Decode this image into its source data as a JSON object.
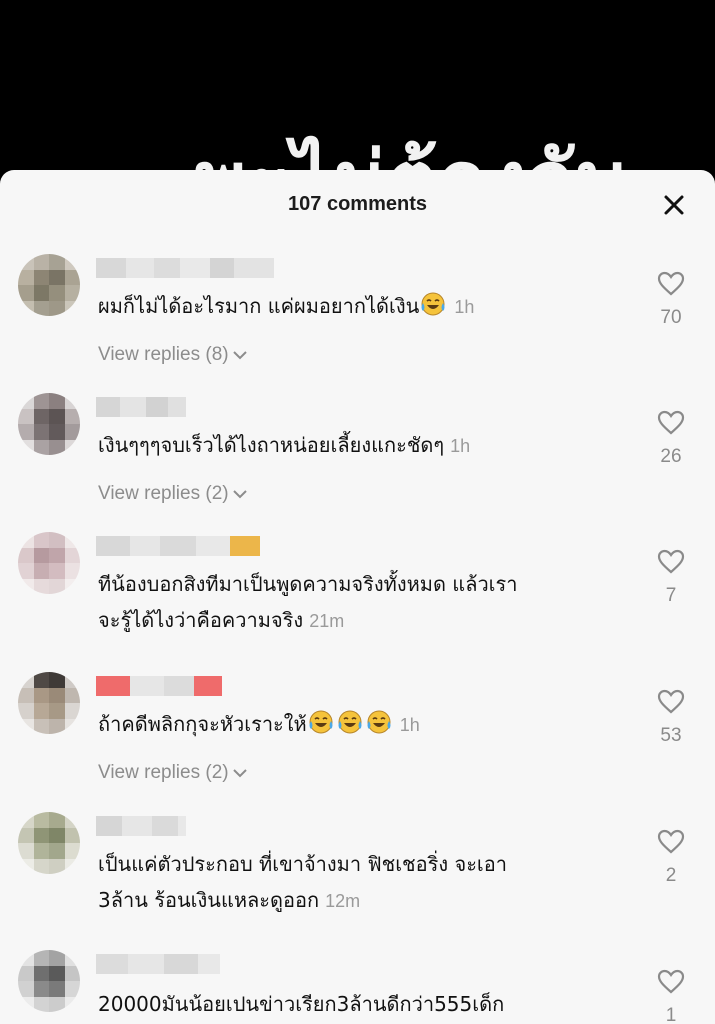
{
  "video": {
    "caption": "พะไม่ต้องจับ"
  },
  "sheet": {
    "title": "107 comments"
  },
  "comments": [
    {
      "text": "ผมก็ไม่ได้อะไรมาก แค่ผมอยากได้เงิน",
      "emojis": 1,
      "time": "1h",
      "likes": "70",
      "replies": "View replies (8)"
    },
    {
      "text": "เงินๆๆๆจบเร็วได้ไงถาหน่อยเลี้ยงแกะชัดๆ",
      "emojis": 0,
      "time": "1h",
      "likes": "26",
      "replies": "View replies (2)"
    },
    {
      "text": "ทีน้องบอกสิงทีมาเป็นพูดความจริงทั้งหมด แล้วเรา",
      "text2": "จะรู้ได้ไงว่าคือความจริง",
      "emojis": 0,
      "time": "21m",
      "likes": "7",
      "replies": ""
    },
    {
      "text": "ถ้าคดีพลิกกุจะหัวเราะให้",
      "emojis": 3,
      "time": "1h",
      "likes": "53",
      "replies": "View replies (2)"
    },
    {
      "text": "เป็นแค่ตัวประกอบ ที่เขาจ้างมา ฟิชเชอริ่ง จะเอา",
      "text2": "3ล้าน ร้อนเงินแหละดูออก",
      "emojis": 0,
      "time": "12m",
      "likes": "2",
      "replies": ""
    },
    {
      "text": "20000มันน้อยเปนข่าวเรียก3ล้านดีกว่า555เด็ก",
      "emojis": 0,
      "time": "",
      "likes": "1",
      "replies": ""
    }
  ],
  "colors": {
    "sheet_bg": "#f7f7f7",
    "text": "#111111",
    "muted": "#8c8c8c",
    "emoji_face": "#f5c33b",
    "emoji_tears": "#4aa8e8"
  },
  "icons": [
    "close-icon",
    "heart-outline-icon",
    "chevron-down-icon",
    "laughing-crying-emoji"
  ]
}
